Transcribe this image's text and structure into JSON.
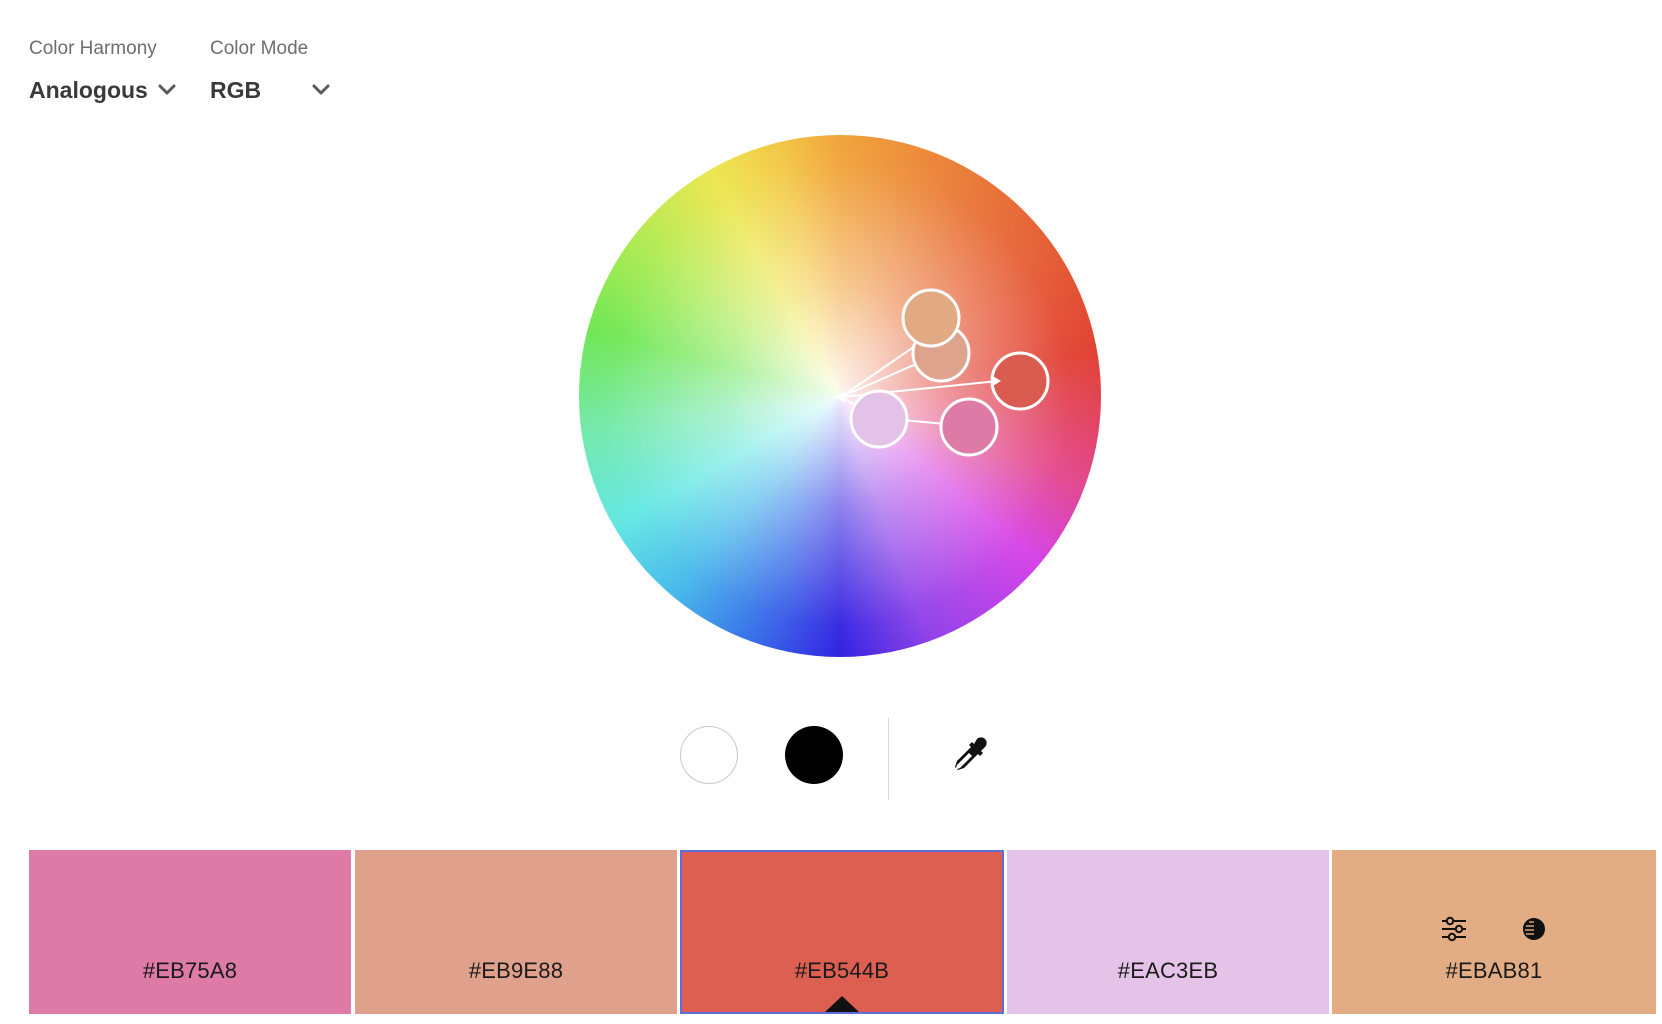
{
  "controls": {
    "harmony": {
      "label": "Color Harmony",
      "value": "Analogous"
    },
    "mode": {
      "label": "Color Mode",
      "value": "RGB"
    }
  },
  "icons": {
    "dropdown": "chevron-down-icon",
    "white": "white-swatch-icon",
    "black": "black-swatch-icon",
    "eyedropper": "eyedropper-icon",
    "adjust": "sliders-icon",
    "contrast": "contrast-icon"
  },
  "swatches": [
    {
      "hex": "#EB75A8",
      "color": "#dd7aa6"
    },
    {
      "hex": "#EB9E88",
      "color": "#e0a18c"
    },
    {
      "hex": "#EB544B",
      "color": "#dc5f52",
      "selected": true
    },
    {
      "hex": "#EAC3EB",
      "color": "#e5c3e8"
    },
    {
      "hex": "#EBAB81",
      "color": "#e2ac84"
    }
  ],
  "wheel_handles": [
    {
      "name": "handle-1",
      "fill": "#e1aa82"
    },
    {
      "name": "handle-2",
      "fill": "#dea38d"
    },
    {
      "name": "handle-base",
      "fill": "#da5b4f"
    },
    {
      "name": "handle-4",
      "fill": "#e2c2e6"
    },
    {
      "name": "handle-5",
      "fill": "#dd7ba6"
    }
  ],
  "colors": {
    "selected_border": "#5a6fd8"
  }
}
